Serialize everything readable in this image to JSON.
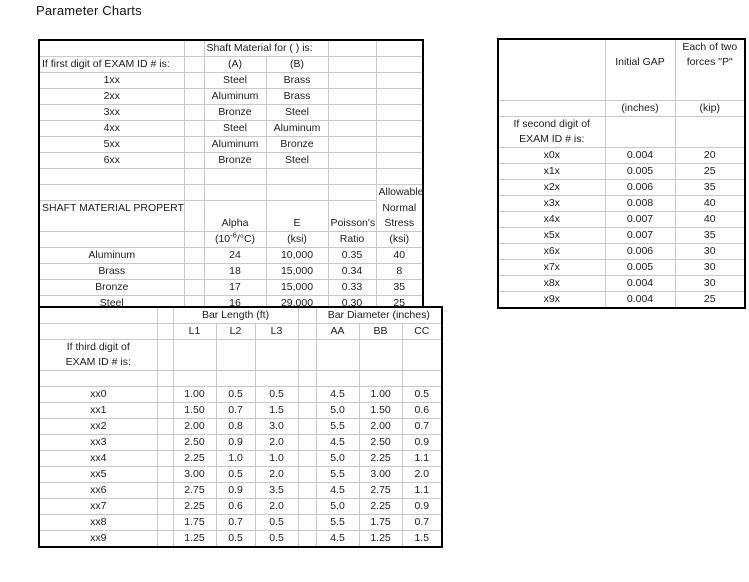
{
  "page": {
    "title": "Parameter Charts"
  },
  "shaft_material_table": {
    "heading_shaft_material": "Shaft Material for (  ) is:",
    "row_label_first_digit": "If first digit of EXAM ID # is:",
    "col_a": "(A)",
    "col_b": "(B)",
    "rows": [
      {
        "id": "1xx",
        "a": "Steel",
        "b": "Brass"
      },
      {
        "id": "2xx",
        "a": "Aluminum",
        "b": "Brass"
      },
      {
        "id": "3xx",
        "a": "Bronze",
        "b": "Steel"
      },
      {
        "id": "4xx",
        "a": "Steel",
        "b": "Aluminum"
      },
      {
        "id": "5xx",
        "a": "Aluminum",
        "b": "Bronze"
      },
      {
        "id": "6xx",
        "a": "Bronze",
        "b": "Steel"
      }
    ],
    "properties_title": "SHAFT MATERIAL PROPERTIES",
    "prop_headers": {
      "alpha": "Alpha",
      "alpha_units_prefix": "(10",
      "alpha_units_exp": "-6",
      "alpha_units_suffix": "/°C)",
      "e": "E",
      "e_units": "(ksi)",
      "poisson_line1": "Poisson's",
      "poisson_line2": "Ratio",
      "allowable_line1": "Allowable",
      "allowable_line2": "Normal",
      "allowable_line3": "Stress",
      "allowable_units": "(ksi)"
    },
    "properties": [
      {
        "material": "Aluminum",
        "alpha": "24",
        "e": "10,000",
        "poisson": "0.35",
        "stress": "40"
      },
      {
        "material": "Brass",
        "alpha": "18",
        "e": "15,000",
        "poisson": "0.34",
        "stress": "8"
      },
      {
        "material": "Bronze",
        "alpha": "17",
        "e": "15,000",
        "poisson": "0.33",
        "stress": "35"
      },
      {
        "material": "Steel",
        "alpha": "16",
        "e": "29,000",
        "poisson": "0.30",
        "stress": "25"
      }
    ]
  },
  "gap_forces_table": {
    "header_gap": "Initial GAP",
    "header_force_line1": "Each of two",
    "header_force_line2": "forces \"P\"",
    "units_gap": "(inches)",
    "units_force": "(kip)",
    "row_label_line1": "If second digit of",
    "row_label_line2": "EXAM ID # is:",
    "rows": [
      {
        "id": "x0x",
        "gap": "0.004",
        "force": "20"
      },
      {
        "id": "x1x",
        "gap": "0.005",
        "force": "25"
      },
      {
        "id": "x2x",
        "gap": "0.006",
        "force": "35"
      },
      {
        "id": "x3x",
        "gap": "0.008",
        "force": "40"
      },
      {
        "id": "x4x",
        "gap": "0.007",
        "force": "40"
      },
      {
        "id": "x5x",
        "gap": "0.007",
        "force": "35"
      },
      {
        "id": "x6x",
        "gap": "0.006",
        "force": "30"
      },
      {
        "id": "x7x",
        "gap": "0.005",
        "force": "30"
      },
      {
        "id": "x8x",
        "gap": "0.004",
        "force": "30"
      },
      {
        "id": "x9x",
        "gap": "0.004",
        "force": "25"
      }
    ]
  },
  "bar_dims_table": {
    "group_length": "Bar Length (ft)",
    "group_diameter": "Bar Diameter (inches)",
    "cols": {
      "l1": "L1",
      "l2": "L2",
      "l3": "L3",
      "aa": "AA",
      "bb": "BB",
      "cc": "CC"
    },
    "row_label_line1": "If third digit of",
    "row_label_line2": "EXAM ID # is:",
    "rows": [
      {
        "id": "xx0",
        "l1": "1.00",
        "l2": "0.5",
        "l3": "0.5",
        "aa": "4.5",
        "bb": "1.00",
        "cc": "0.5"
      },
      {
        "id": "xx1",
        "l1": "1.50",
        "l2": "0.7",
        "l3": "1.5",
        "aa": "5.0",
        "bb": "1.50",
        "cc": "0.6"
      },
      {
        "id": "xx2",
        "l1": "2.00",
        "l2": "0.8",
        "l3": "3.0",
        "aa": "5.5",
        "bb": "2.00",
        "cc": "0.7"
      },
      {
        "id": "xx3",
        "l1": "2.50",
        "l2": "0.9",
        "l3": "2.0",
        "aa": "4.5",
        "bb": "2.50",
        "cc": "0.9"
      },
      {
        "id": "xx4",
        "l1": "2.25",
        "l2": "1.0",
        "l3": "1.0",
        "aa": "5.0",
        "bb": "2.25",
        "cc": "1.1"
      },
      {
        "id": "xx5",
        "l1": "3.00",
        "l2": "0.5",
        "l3": "2.0",
        "aa": "5.5",
        "bb": "3.00",
        "cc": "2.0"
      },
      {
        "id": "xx6",
        "l1": "2.75",
        "l2": "0.9",
        "l3": "3.5",
        "aa": "4.5",
        "bb": "2.75",
        "cc": "1.1"
      },
      {
        "id": "xx7",
        "l1": "2.25",
        "l2": "0.6",
        "l3": "2.0",
        "aa": "5.0",
        "bb": "2.25",
        "cc": "0.9"
      },
      {
        "id": "xx8",
        "l1": "1.75",
        "l2": "0.7",
        "l3": "0.5",
        "aa": "5.5",
        "bb": "1.75",
        "cc": "0.7"
      },
      {
        "id": "xx9",
        "l1": "1.25",
        "l2": "0.5",
        "l3": "0.5",
        "aa": "4.5",
        "bb": "1.25",
        "cc": "1.5"
      }
    ]
  },
  "colors": {
    "table_border": "#000000",
    "gridline": "#c9c9c9",
    "text": "#1d1d1d",
    "background": "#ffffff"
  }
}
